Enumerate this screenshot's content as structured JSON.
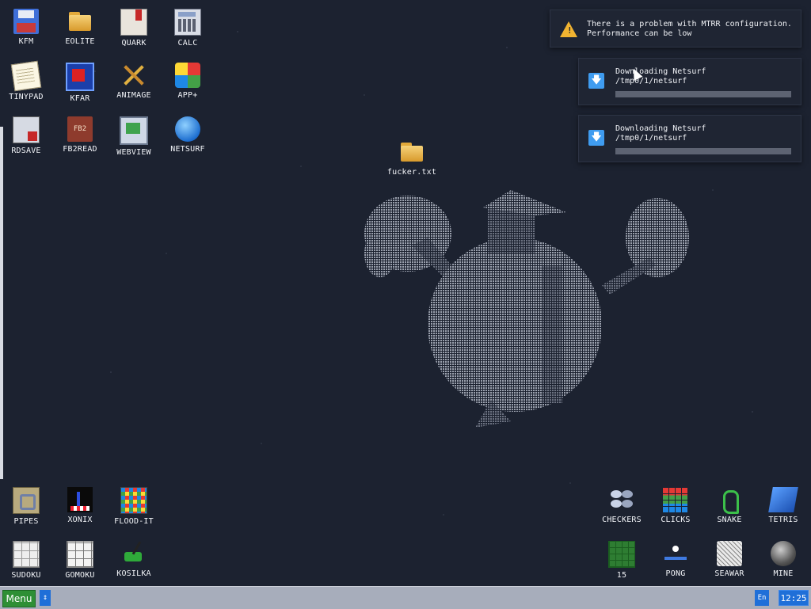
{
  "desktop_icons": {
    "kfm": "KFM",
    "eolite": "EOLITE",
    "quark": "QUARK",
    "calc": "CALC",
    "tinypad": "TINYPAD",
    "kfar": "KFAR",
    "animage": "ANIMAGE",
    "app_plus": "APP+",
    "rdsave": "RDSAVE",
    "fb2read": "FB2READ",
    "webview": "WEBVIEW",
    "netsurf": "NETSURF",
    "file": "fucker.txt",
    "pipes": "PIPES",
    "xonix": "XONIX",
    "flood_it": "FLOOD-IT",
    "sudoku": "SUDOKU",
    "gomoku": "GOMOKU",
    "kosilka": "KOSILKA",
    "checkers": "CHECKERS",
    "clicks": "CLICKS",
    "snake": "SNAKE",
    "tetris": "TETRIS",
    "fifteen": "15",
    "pong": "PONG",
    "seawar": "SEAWAR",
    "mine": "MINE"
  },
  "icon_glyphs": {
    "fb2": "FB2"
  },
  "notifications": {
    "warning": {
      "line1": "There is a problem with MTRR configuration.",
      "line2": "Performance can be low",
      "icon": "warning-triangle-icon",
      "glyph": "!"
    },
    "download1": {
      "title": "Downloading Netsurf",
      "path": "/tmp0/1/netsurf",
      "icon": "download-arrow-icon",
      "glyph": "🡇",
      "progress": 0.0
    },
    "download2": {
      "title": "Downloading Netsurf",
      "path": "/tmp0/1/netsurf",
      "icon": "download-arrow-icon",
      "glyph": "🡇",
      "progress": 0.0
    }
  },
  "taskbar": {
    "menu_label": "Menu",
    "scroll_glyph": "↕",
    "language": "En",
    "clock": "12:25"
  },
  "colors": {
    "desktop_bg": "#1c2230",
    "taskbar_bg": "#a7adbb",
    "menu_green": "#2e8f35",
    "accent_blue": "#1f6fd8",
    "warning_yellow": "#f2b431"
  }
}
